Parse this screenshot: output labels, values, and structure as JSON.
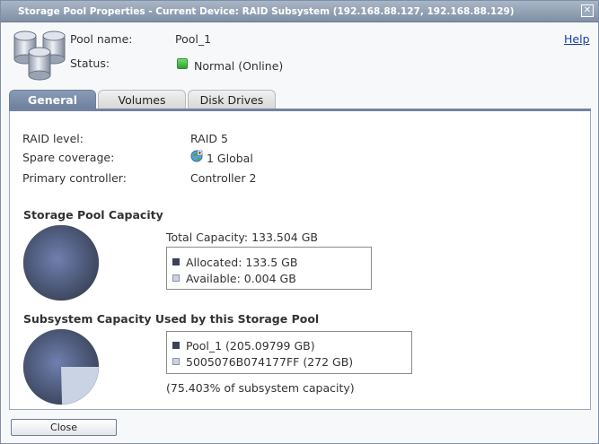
{
  "window": {
    "title": "Storage Pool Properties - Current Device: RAID Subsystem (192.168.88.127, 192.168.88.129)",
    "close_glyph": "✕"
  },
  "header": {
    "pool_name_label": "Pool name:",
    "pool_name_value": "Pool_1",
    "status_label": "Status:",
    "status_value": "Normal (Online)",
    "status_color": "#3cbf38",
    "help_link": "Help",
    "icon": "storage-pool-icon"
  },
  "tabs": [
    {
      "label": "General",
      "active": true
    },
    {
      "label": "Volumes",
      "active": false
    },
    {
      "label": "Disk Drives",
      "active": false
    }
  ],
  "general": {
    "raid_level_label": "RAID level:",
    "raid_level_value": "RAID 5",
    "spare_label": "Spare coverage:",
    "spare_value": "1 Global",
    "spare_icon": "global-spare-icon",
    "controller_label": "Primary controller:",
    "controller_value": "Controller 2"
  },
  "pool_capacity": {
    "title": "Storage Pool Capacity",
    "total": "Total Capacity: 133.504 GB",
    "legend": [
      {
        "label": "Allocated: 133.5 GB",
        "color": "#3a4358"
      },
      {
        "label": "Available: 0.004 GB",
        "color": "#c9d3e3"
      }
    ],
    "allocated_fraction": 0.99997
  },
  "subsystem_capacity": {
    "title": "Subsystem Capacity Used by this Storage Pool",
    "legend": [
      {
        "label": "Pool_1 (205.09799 GB)",
        "color": "#3a4358"
      },
      {
        "label": "5005076B074177FF (272 GB)",
        "color": "#c9d3e3"
      }
    ],
    "note": "(75.403% of subsystem capacity)",
    "used_fraction": 0.75403
  },
  "footer": {
    "close_label": "Close"
  }
}
